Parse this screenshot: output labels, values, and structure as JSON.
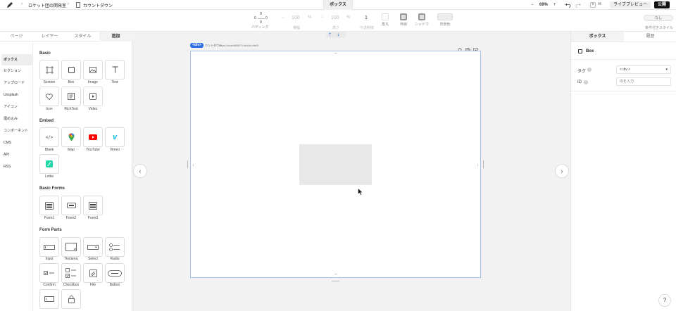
{
  "topbar": {
    "breadcrumb_project": "ロケット団の開発室",
    "breadcrumb_page": "カウントダウン",
    "active_tab": "ボックス",
    "zoom": "69%",
    "zoom_minus": "−",
    "zoom_plus": "+",
    "add_icon_label": "+",
    "shortcut": "⌘",
    "preview_label": "ライブプレビュー",
    "publish_label": "公開"
  },
  "toolbar": {
    "padding_top": "0",
    "padding_left": "0",
    "padding_right": "0",
    "padding_bottom": "0",
    "padding_label": "パディング",
    "width_value": "100",
    "width_unit": "%",
    "width_label": "横幅",
    "height_value": "100",
    "height_unit": "%",
    "height_label": "高さ",
    "opacity_value": "1",
    "opacity_label": "不透明度",
    "radius_label": "角丸",
    "border_label": "枠線",
    "shadow_label": "シャドウ",
    "bg_label": "背景色",
    "condition_value": "なし",
    "condition_label": "条件付きスタイル"
  },
  "left_tabs": [
    "ページ",
    "レイヤー",
    "スタイル",
    "追加"
  ],
  "left_nav": [
    "ボックス",
    "セクション",
    "アップロード",
    "Unsplash",
    "アイコン",
    "埋め込み",
    "コンポーネント",
    "CMS",
    "API",
    "RSS"
  ],
  "sections": {
    "basic": {
      "title": "Basic",
      "items": [
        "Section",
        "Box",
        "Image",
        "Text",
        "Icon",
        "RichText",
        "Video"
      ]
    },
    "embed": {
      "title": "Embed",
      "items": [
        "Blank",
        "Map",
        "YouTube",
        "Vimeo",
        "Lottie"
      ]
    },
    "basic_forms": {
      "title": "Basic Forms",
      "items": [
        "Form1",
        "Form2",
        "Form3"
      ]
    },
    "form_parts": {
      "title": "Form Parts",
      "items": [
        "Input",
        "Textarea",
        "Select",
        "Radio",
        "Confirm",
        "Checkbox",
        "File",
        "Button"
      ]
    }
  },
  "canvas": {
    "element_tag": "<div>",
    "page_label": "ウントダウン",
    "url": "https://cuan866879.studio.site/5"
  },
  "right_panel": {
    "tab_box": "ボックス",
    "tab_history": "履歴",
    "component_name": "Box",
    "tag_label": "タグ",
    "tag_value": "< div >",
    "id_label": "ID",
    "id_placeholder": "IDを入力"
  },
  "help_label": "?",
  "colors": {
    "accent": "#2f6fe4",
    "publish_bg": "#111111",
    "frame_border": "#a9c3e8"
  }
}
